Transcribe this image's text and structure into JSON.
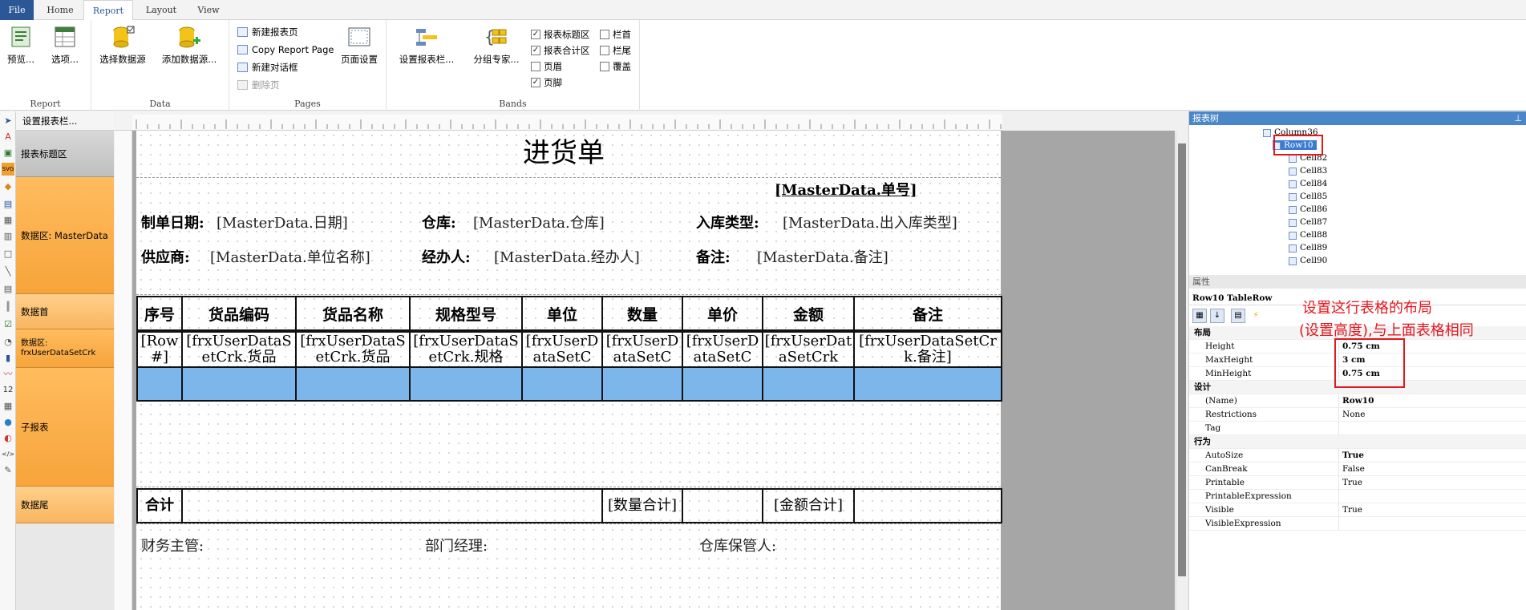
{
  "tabs": [
    "File",
    "Home",
    "Report",
    "Layout",
    "View"
  ],
  "ribbon": {
    "report": {
      "name": "Report",
      "preview": "预览...",
      "options": "选项..."
    },
    "data": {
      "name": "Data",
      "select": "选择数据源",
      "add": "添加数据源..."
    },
    "pages": {
      "name": "Pages",
      "new_page": "新建报表页",
      "copy_page": "Copy Report Page",
      "new_dialog": "新建对话框",
      "delete_page": "删除页",
      "page_setup": "页面设置"
    },
    "bands": {
      "name": "Bands",
      "setup": "设置报表栏...",
      "group": "分组专家...",
      "checks": [
        {
          "label": "报表标题区",
          "checked": true
        },
        {
          "label": "报表合计区",
          "checked": true
        },
        {
          "label": "页眉",
          "checked": false
        },
        {
          "label": "页脚",
          "checked": true
        },
        {
          "label": "栏首",
          "checked": false
        },
        {
          "label": "栏尾",
          "checked": false
        },
        {
          "label": "覆盖",
          "checked": false
        }
      ]
    }
  },
  "band_header": "设置报表栏...",
  "bands": [
    "报表标题区",
    "数据区: MasterData",
    "数据首",
    "数据区: frxUserDataSetCrk",
    "子报表",
    "数据尾"
  ],
  "report": {
    "title": "进货单",
    "order_no": "[MasterData.单号]",
    "labels": {
      "date": "制单日期:",
      "warehouse": "仓库:",
      "type": "入库类型:",
      "supplier": "供应商:",
      "handler": "经办人:",
      "remark": "备注:"
    },
    "values": {
      "date": "[MasterData.日期]",
      "warehouse": "[MasterData.仓库]",
      "type": "[MasterData.出入库类型]",
      "supplier": "[MasterData.单位名称]",
      "handler": "[MasterData.经办人]",
      "remark": "[MasterData.备注]"
    },
    "columns": [
      "序号",
      "货品编码",
      "货品名称",
      "规格型号",
      "单位",
      "数量",
      "单价",
      "金额",
      "备注"
    ],
    "data_cells": [
      "[Row#]",
      "[frxUserDataSetCrk.货品",
      "[frxUserDataSetCrk.货品",
      "[frxUserDataSetCrk.规格",
      "[frxUserDataSetC",
      "[frxUserDataSetC",
      "[frxUserDataSetC",
      "[frxUserDataSetCrk",
      "[frxUserDataSetCrk.备注]"
    ],
    "sum_label": "合计",
    "sum_qty": "[数量合计]",
    "sum_amount": "[金额合计]",
    "footer": {
      "finance": "财务主管:",
      "dept": "部门经理:",
      "keeper": "仓库保管人:"
    }
  },
  "tree": {
    "title": "报表树",
    "nodes": [
      "Column36",
      "Row10",
      "Cell82",
      "Cell83",
      "Cell84",
      "Cell85",
      "Cell86",
      "Cell87",
      "Cell88",
      "Cell89",
      "Cell90"
    ]
  },
  "props": {
    "title": "属性",
    "object": "Row10 TableRow",
    "categories": {
      "layout": "布局",
      "design": "设计",
      "behavior": "行为"
    },
    "layout_rows": [
      [
        "Height",
        "0.75 cm"
      ],
      [
        "MaxHeight",
        "3 cm"
      ],
      [
        "MinHeight",
        "0.75 cm"
      ]
    ],
    "design_rows": [
      [
        "(Name)",
        "Row10"
      ],
      [
        "Restrictions",
        "None"
      ],
      [
        "Tag",
        ""
      ]
    ],
    "behavior_rows": [
      [
        "AutoSize",
        "True"
      ],
      [
        "CanBreak",
        "False"
      ],
      [
        "Printable",
        "True"
      ],
      [
        "PrintableExpression",
        ""
      ],
      [
        "Visible",
        "True"
      ],
      [
        "VisibleExpression",
        ""
      ]
    ]
  },
  "annotation": {
    "line1": "设置这行表格的布局",
    "line2": "(设置高度),与上面表格相同"
  },
  "colors": {
    "accent": "#2b5797",
    "selection": "#7cb6ea",
    "annotation": "#e4161e",
    "band": "#f7a43b"
  }
}
